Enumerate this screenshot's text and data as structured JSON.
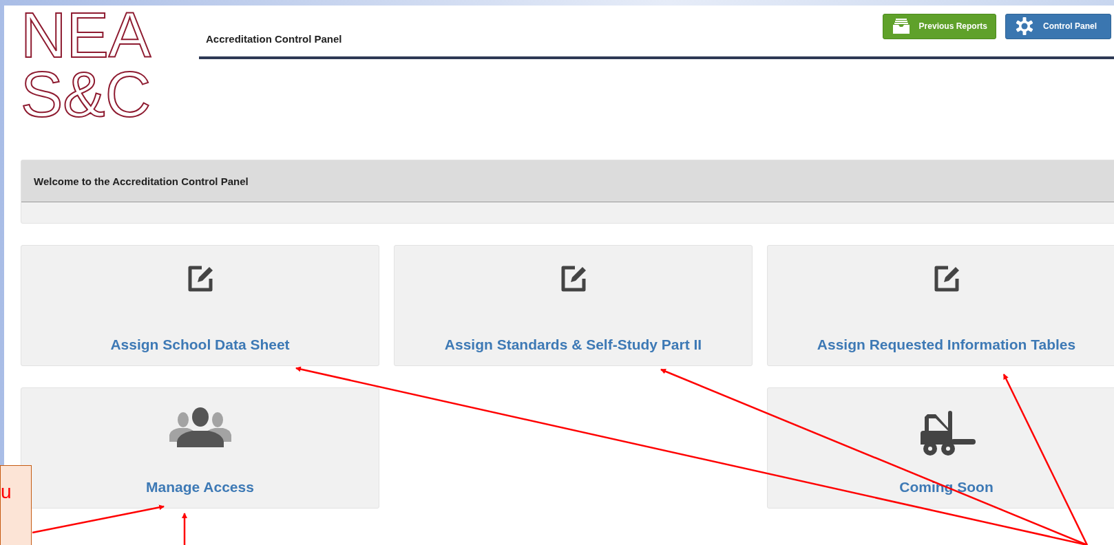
{
  "logo": {
    "lines": [
      "NEA",
      "S&C"
    ]
  },
  "header": {
    "title": "Accreditation Control Panel",
    "buttons": [
      {
        "label": "Previous Reports",
        "kind": "reports"
      },
      {
        "label": "Control Panel",
        "kind": "settings"
      }
    ]
  },
  "welcome": {
    "title": "Welcome to the Accreditation Control Panel"
  },
  "tile_rows": [
    [
      {
        "label": "Assign School Data Sheet",
        "kind": "edit"
      },
      {
        "label": "Assign Standards & Self-Study Part II",
        "kind": "edit"
      },
      {
        "label": "Assign Requested Information Tables",
        "kind": "edit"
      }
    ],
    [
      {
        "label": "Manage Access",
        "kind": "people"
      },
      null,
      {
        "label": "Coming Soon",
        "kind": "forklift"
      }
    ]
  ],
  "callout": {
    "text": "u"
  }
}
